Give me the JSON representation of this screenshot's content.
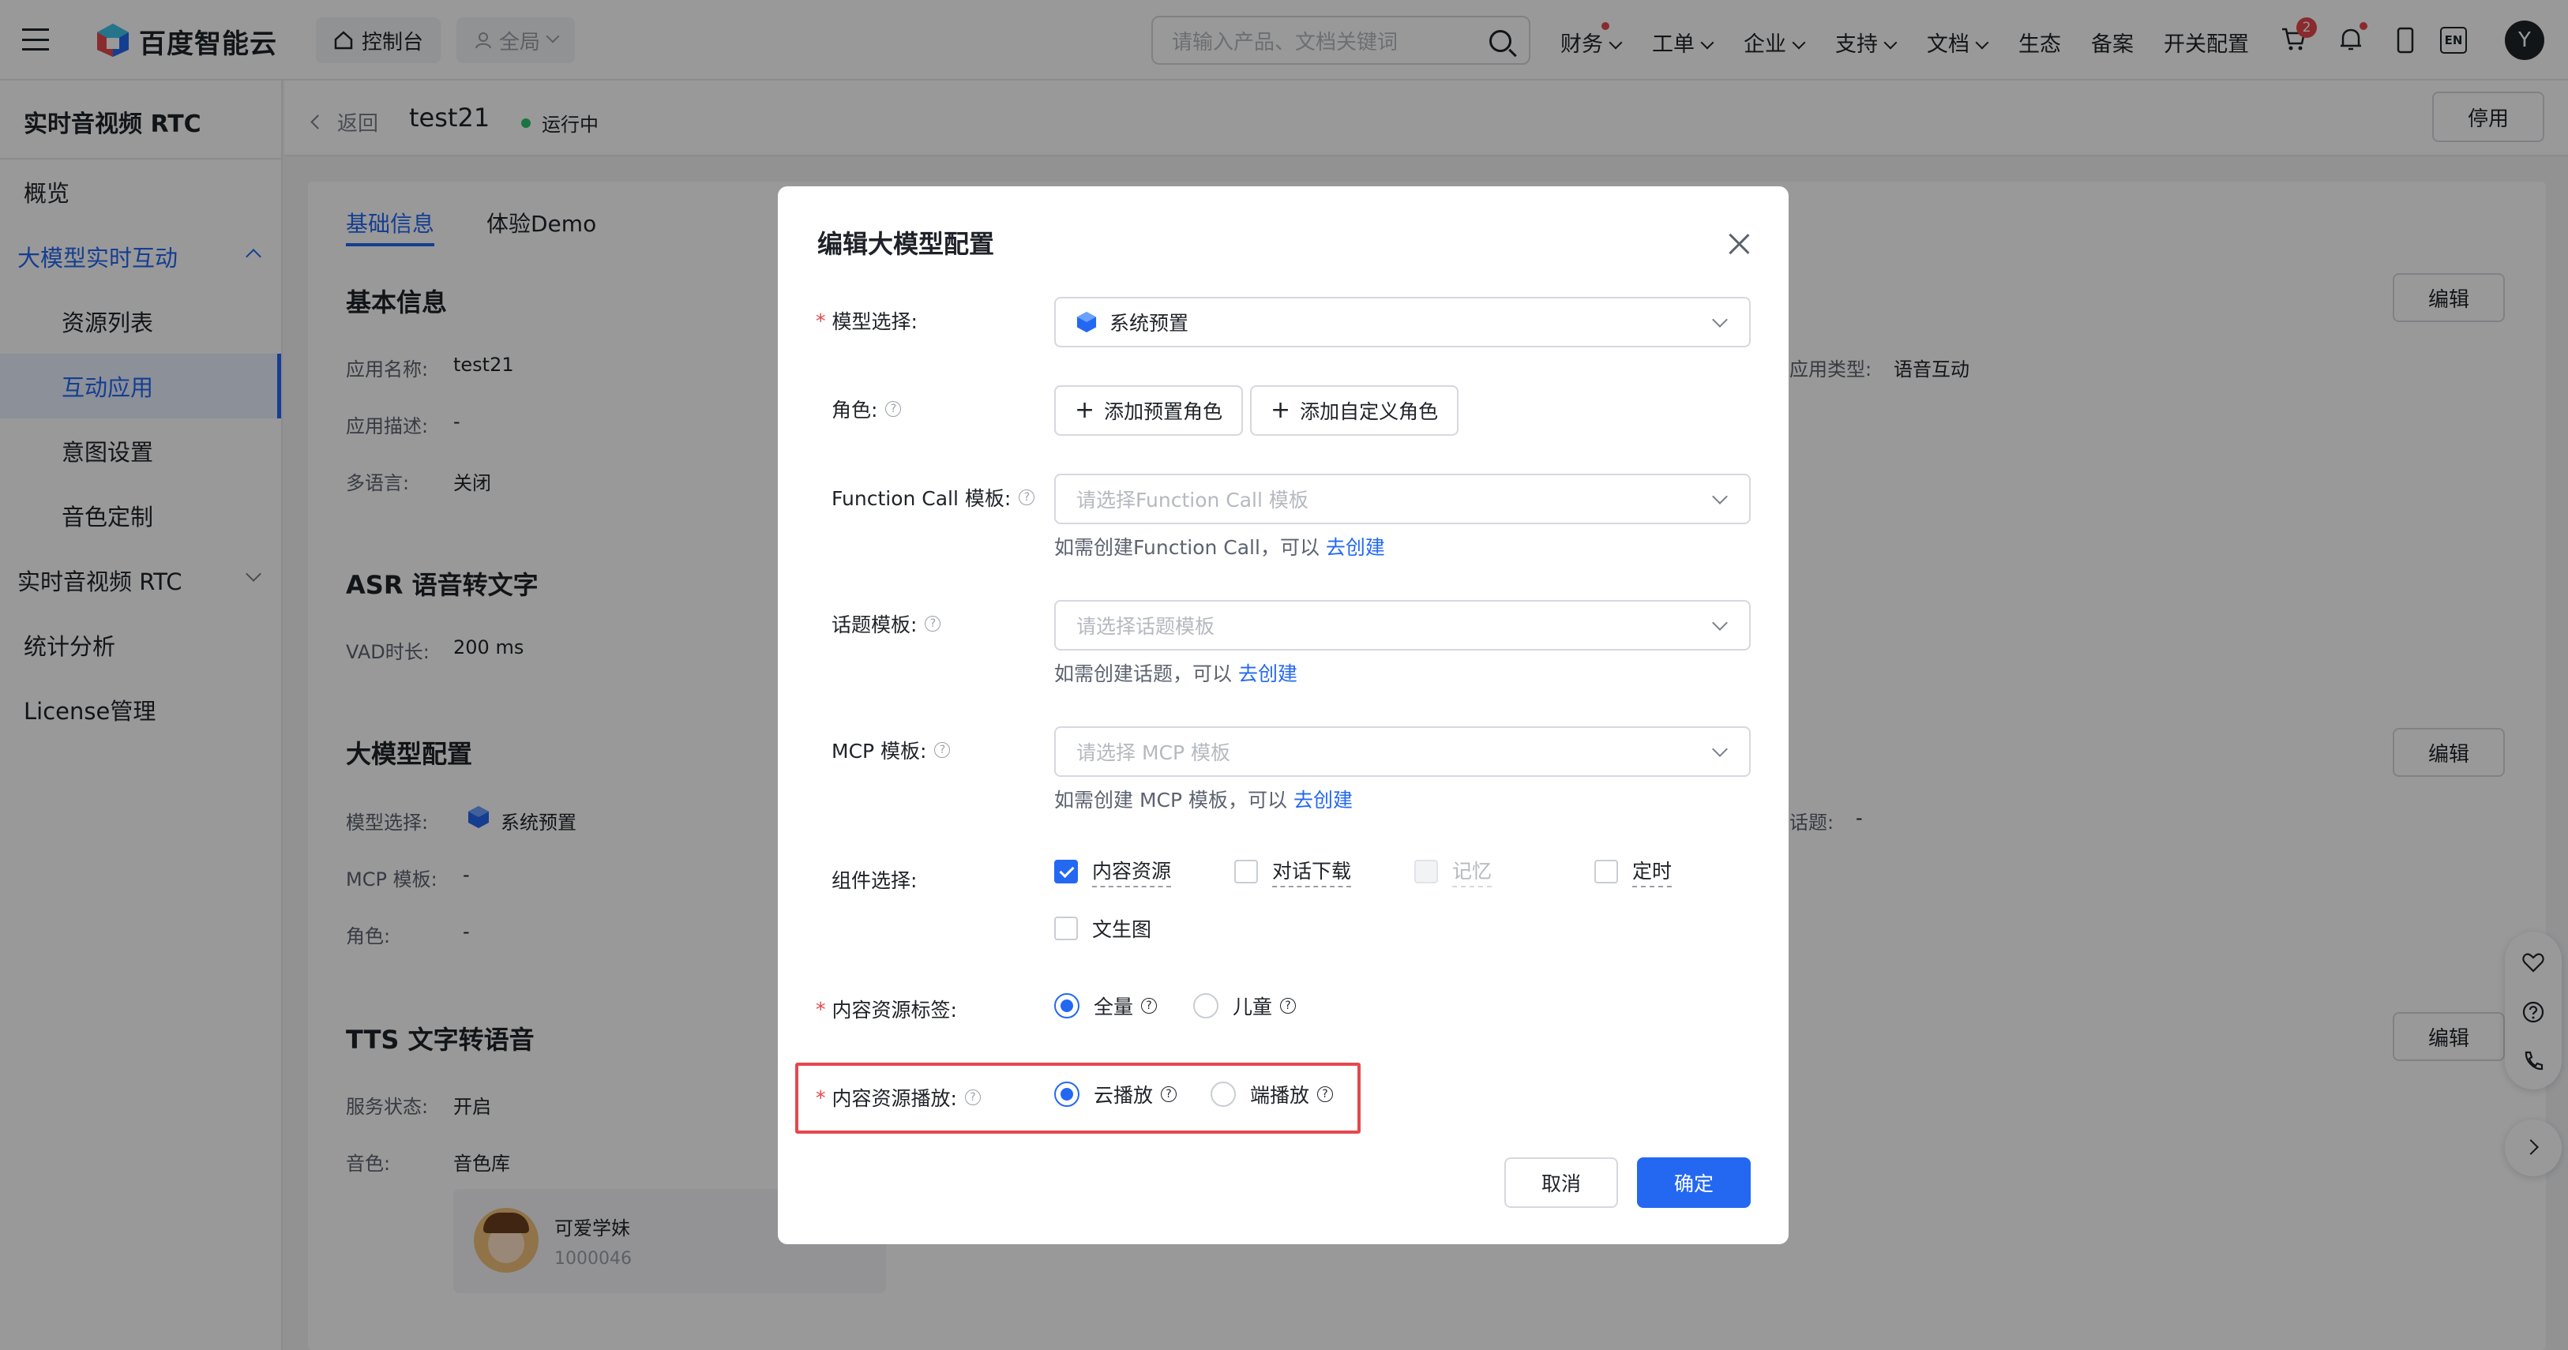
{
  "brand": {
    "name": "百度智能云"
  },
  "topbar": {
    "console_label": "控制台",
    "region_label": "全局",
    "search_placeholder": "请输入产品、文档关键词",
    "nav": [
      "财务",
      "工单",
      "企业",
      "支持",
      "文档",
      "生态",
      "备案",
      "开关配置"
    ],
    "cart_badge": "2",
    "lang": "EN",
    "avatar": "Y"
  },
  "sidebar": {
    "title": "实时音视频 RTC",
    "items": [
      {
        "label": "概览"
      },
      {
        "label": "大模型实时互动"
      },
      {
        "label": "资源列表"
      },
      {
        "label": "互动应用"
      },
      {
        "label": "意图设置"
      },
      {
        "label": "音色定制"
      },
      {
        "label": "实时音视频 RTC"
      },
      {
        "label": "统计分析"
      },
      {
        "label": "License管理"
      }
    ]
  },
  "header": {
    "back": "返回",
    "app_name": "test21",
    "status": "运行中",
    "stop_button": "停用"
  },
  "tabs": [
    "基础信息",
    "体验Demo"
  ],
  "basic": {
    "title": "基本信息",
    "edit": "编辑",
    "name_label": "应用名称:",
    "name_value": "test21",
    "desc_label": "应用描述:",
    "desc_value": "-",
    "lang_label": "多语言:",
    "lang_value": "关闭",
    "type_label": "应用类型:",
    "type_value": "语音互动"
  },
  "asr": {
    "title": "ASR 语音转文字",
    "vad_label": "VAD时长:",
    "vad_value": "200 ms"
  },
  "llm": {
    "title": "大模型配置",
    "edit": "编辑",
    "model_label": "模型选择:",
    "model_value": "系统预置",
    "mcp_label": "MCP 模板:",
    "mcp_value": "-",
    "role_label": "角色:",
    "role_value": "-",
    "topic_label": "话题:",
    "topic_value": "-"
  },
  "tts": {
    "title": "TTS 文字转语音",
    "edit": "编辑",
    "status_label": "服务状态:",
    "status_value": "开启",
    "voice_label": "音色:",
    "voice_value": "音色库",
    "voice_name": "可爱学妹",
    "voice_id": "1000046"
  },
  "modal": {
    "title": "编辑大模型配置",
    "model_label": "模型选择:",
    "model_value": "系统预置",
    "role_label": "角色:",
    "add_preset_role": "添加预置角色",
    "add_custom_role": "添加自定义角色",
    "fc_label": "Function Call 模板:",
    "fc_placeholder": "请选择Function Call 模板",
    "fc_hint": "如需创建Function Call，可以",
    "topic_label": "话题模板:",
    "topic_placeholder": "请选择话题模板",
    "topic_hint": "如需创建话题，可以",
    "mcp_label": "MCP 模板:",
    "mcp_placeholder": "请选择 MCP 模板",
    "mcp_hint": "如需创建 MCP 模板，可以",
    "create_link": "去创建",
    "components_label": "组件选择:",
    "components": [
      {
        "label": "内容资源",
        "checked": true
      },
      {
        "label": "对话下载",
        "checked": false
      },
      {
        "label": "记忆",
        "checked": false,
        "disabled": true
      },
      {
        "label": "定时",
        "checked": false
      },
      {
        "label": "文生图",
        "checked": false
      }
    ],
    "tag_label": "内容资源标签:",
    "tag_options": [
      "全量",
      "儿童"
    ],
    "play_label": "内容资源播放:",
    "play_options": [
      "云播放",
      "端播放"
    ],
    "cancel": "取消",
    "confirm": "确定",
    "help": "?"
  },
  "colors": {
    "accent": "#2468f2",
    "required": "#e5484d",
    "status_green": "#2ec26a",
    "highlight_box": "#e5484d"
  }
}
